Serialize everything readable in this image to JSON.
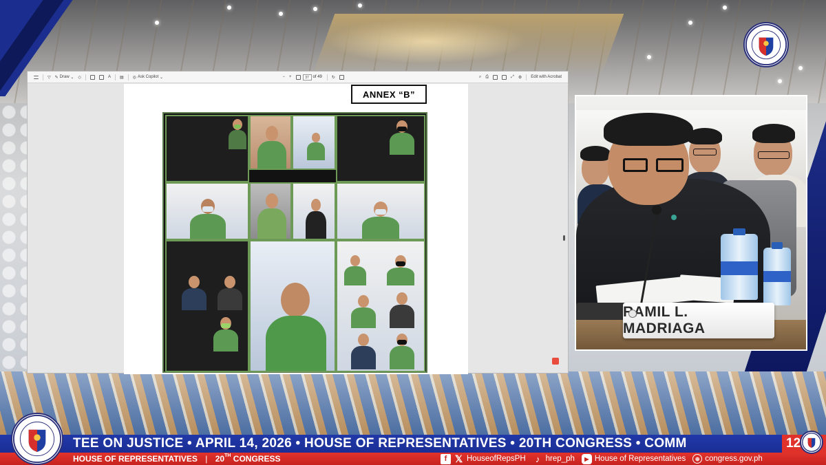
{
  "pdf_viewer": {
    "toolbar": {
      "draw_label": "Draw",
      "copilot_label": "Ask Copilot",
      "page_current": "37",
      "page_total": "of 49",
      "edit_label": "Edit with Acrobat"
    },
    "page": {
      "annex_label": "ANNEX “B”"
    }
  },
  "speaker": {
    "nameplate": "RAMIL L. MADRIAGA"
  },
  "ticker": {
    "text": "TEE ON JUSTICE  •  APRIL 14, 2026  •  HOUSE OF REPRESENTATIVES  •  20TH CONGRESS  •  COMM",
    "end_text": "12"
  },
  "bottom_bar": {
    "house_label": "HOUSE OF REPRESENTATIVES",
    "congress_number": "20",
    "congress_suffix": "TH",
    "congress_word": "CONGRESS",
    "facebook_x_handle": "HouseofRepsPH",
    "tiktok_handle": "hrep_ph",
    "youtube_name": "House of Representatives",
    "website": "congress.gov.ph"
  },
  "seal": {
    "top_text": "HOUSE OF REPRESENTATIVES",
    "bottom_text": "PHILIPPINES",
    "year": "1907"
  },
  "colors": {
    "ticker_blue": "#1b2e95",
    "bar_red": "#c8231f",
    "zoom_green": "#6d9a56"
  }
}
